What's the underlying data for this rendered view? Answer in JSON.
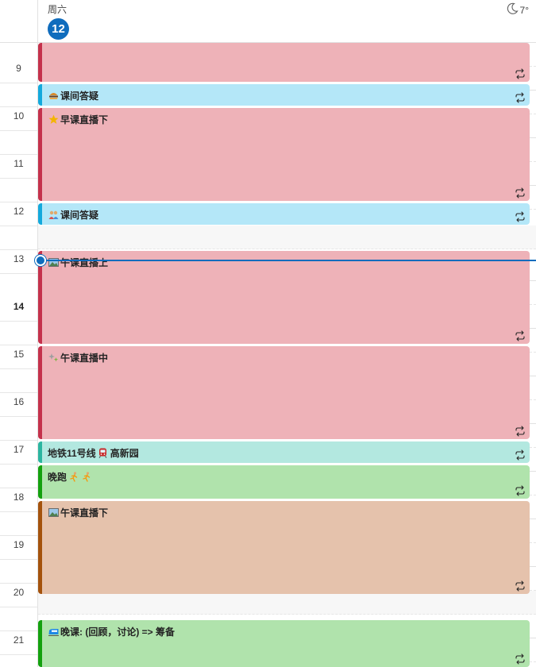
{
  "header": {
    "weekday": "周六",
    "day_number": "12",
    "weather_icon": "moon-icon",
    "temperature": "7°"
  },
  "hours": [
    "9",
    "10",
    "11",
    "12",
    "13",
    "14",
    "15",
    "16",
    "17",
    "18",
    "19",
    "20",
    "21"
  ],
  "current_hour": "14",
  "events": [
    {
      "title": "",
      "icons": [],
      "recurring": true,
      "bar_color": "#c4314b",
      "bg_color": "#eeb2b8"
    },
    {
      "title": "课间答疑",
      "icons": [
        "hamburger-emoji-icon"
      ],
      "recurring": true,
      "bar_color": "#13a9dc",
      "bg_color": "#b4e7f8"
    },
    {
      "title": "早课直播下",
      "icons": [
        "star-emoji-icon"
      ],
      "recurring": true,
      "bar_color": "#c4314b",
      "bg_color": "#eeb2b8"
    },
    {
      "title": "课间答疑",
      "icons": [
        "people-emoji-icon"
      ],
      "recurring": true,
      "bar_color": "#13a9dc",
      "bg_color": "#b4e7f8"
    },
    {
      "title": "午课直播上",
      "icons": [
        "picture-emoji-icon"
      ],
      "recurring": true,
      "bar_color": "#c4314b",
      "bg_color": "#eeb2b8"
    },
    {
      "title": "午课直播中",
      "icons": [
        "sparkle-emoji-icon"
      ],
      "recurring": true,
      "bar_color": "#c4314b",
      "bg_color": "#eeb2b8"
    },
    {
      "title": "地铁11号线",
      "suffix": "高新园",
      "icons": [
        "metro-emoji-icon"
      ],
      "recurring": true,
      "bar_color": "#2bb5a0",
      "bg_color": "#b3e8e0"
    },
    {
      "title": "晚跑",
      "icons": [
        "runner-emoji-icon",
        "runner-emoji-icon"
      ],
      "recurring": true,
      "bar_color": "#13a10e",
      "bg_color": "#b0e3ac"
    },
    {
      "title": "午课直播下",
      "icons": [
        "picture-emoji-icon"
      ],
      "recurring": true,
      "bar_color": "#a4520c",
      "bg_color": "#e5c2ac"
    },
    {
      "title": "晚课: (回顾，讨论) => 筹备",
      "icons": [
        "train-emoji-icon"
      ],
      "recurring": true,
      "bar_color": "#13a10e",
      "bg_color": "#b0e3ac"
    }
  ],
  "recurrence_icon": "repeat-icon"
}
